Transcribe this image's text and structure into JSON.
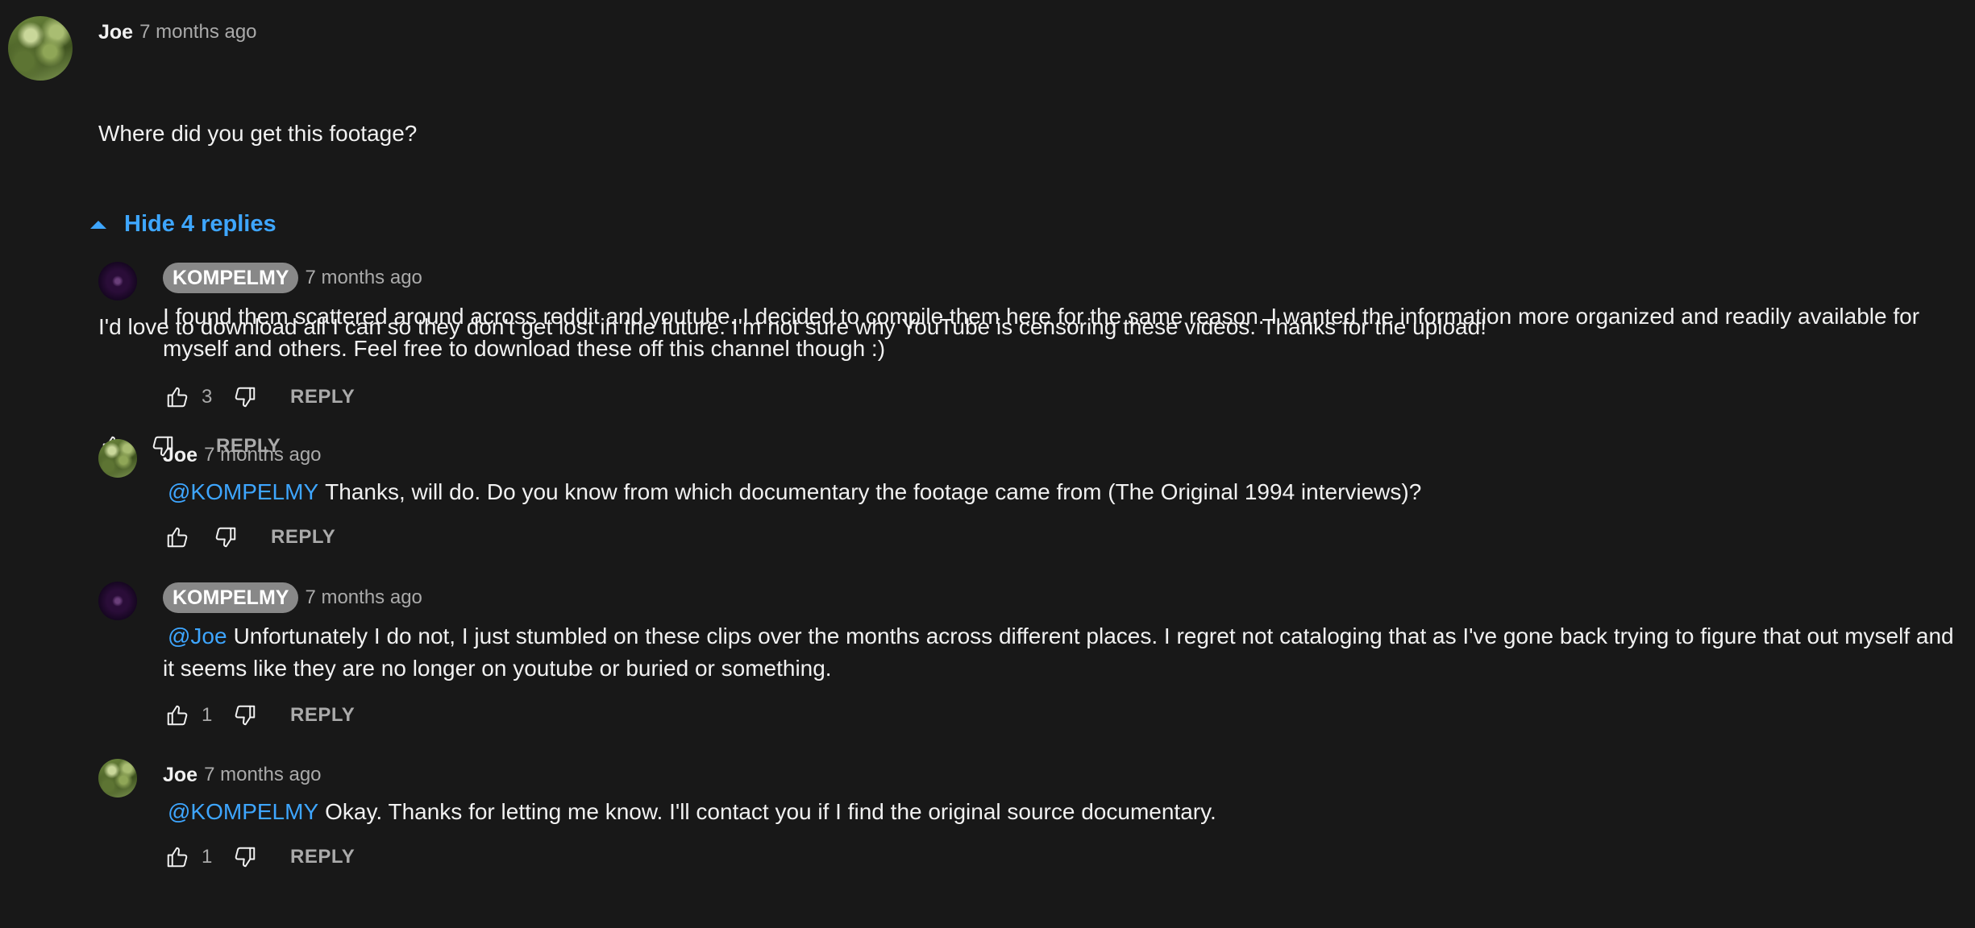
{
  "top_comment": {
    "author": "Joe",
    "time": "7 months ago",
    "text_line1": "Where did you get this footage?",
    "text_line2": "I'd love to download all I can so they don't get lost in the future. I'm not sure why YouTube is censoring these videos. Thanks for the upload!",
    "like_count": "",
    "reply_label": "REPLY",
    "avatar_icon": "avatar-joe"
  },
  "replies_toggle": {
    "label": "Hide 4 replies",
    "icon": "caret-up-icon"
  },
  "replies": [
    {
      "author": "KOMPELMY",
      "author_style": "chip",
      "time": "7 months ago",
      "mention": "",
      "text": "I found them scattered around across reddit and youtube. I decided to compile them here for the same reason. I wanted the information more organized and readily available for myself and others. Feel free to download these off this channel though :)",
      "like_count": "3",
      "reply_label": "REPLY"
    },
    {
      "author": "Joe",
      "author_style": "plain",
      "time": "7 months ago",
      "mention": "@KOMPELMY",
      "text": "Thanks, will do. Do you know from which documentary the footage came from (The Original 1994 interviews)?",
      "like_count": "",
      "reply_label": "REPLY"
    },
    {
      "author": "KOMPELMY",
      "author_style": "chip",
      "time": "7 months ago",
      "mention": "@Joe",
      "text": "Unfortunately I do not, I just stumbled on these clips over the months across different places. I regret not cataloging that as I've gone back trying to figure that out myself and it seems like they are no longer on youtube or buried or something.",
      "like_count": "1",
      "reply_label": "REPLY"
    },
    {
      "author": "Joe",
      "author_style": "plain",
      "time": "7 months ago",
      "mention": "@KOMPELMY",
      "text": "Okay. Thanks for letting me know. I'll contact you if I find the original source documentary.",
      "like_count": "1",
      "reply_label": "REPLY"
    }
  ],
  "colors": {
    "background": "#181818",
    "text": "#f1f1f1",
    "secondary_text": "#aaaaaa",
    "link_blue": "#3ea6ff",
    "author_chip_bg": "#888888"
  }
}
